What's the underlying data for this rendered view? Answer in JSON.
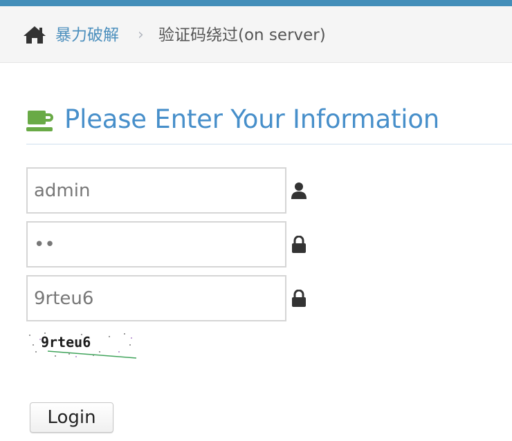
{
  "breadcrumb": {
    "home_icon": "home-icon",
    "parent_label": "暴力破解",
    "separator": "›",
    "current_label": "验证码绕过(on server)"
  },
  "header": {
    "icon": "coffee-cup-icon",
    "title": "Please Enter Your Information"
  },
  "form": {
    "username": {
      "value": "admin",
      "icon": "user-icon"
    },
    "password": {
      "value": "••",
      "icon": "lock-icon"
    },
    "captcha_input": {
      "value": "9rteu6",
      "icon": "lock-icon"
    },
    "captcha_image_text": "9rteu6",
    "login_label": "Login"
  },
  "colors": {
    "topbar": "#438eb9",
    "link": "#4c8fbd",
    "title": "#478fca",
    "cup": "#69aa46"
  }
}
